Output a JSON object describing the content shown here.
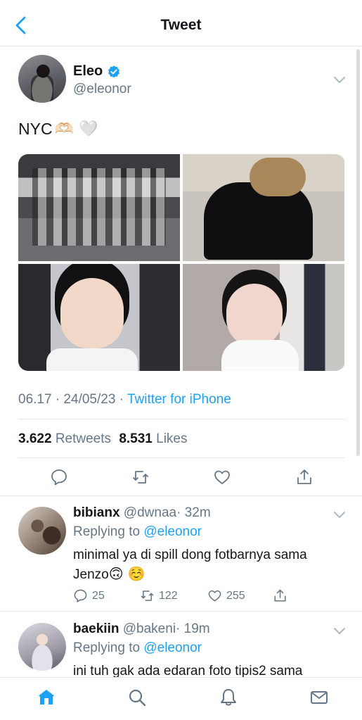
{
  "header": {
    "title": "Tweet"
  },
  "tweet": {
    "name": "Eleo",
    "handle": "@eleonor",
    "text": "NYC",
    "emojis": "🫶🏻 🤍",
    "timestamp": "06.17 · 24/05/23 · ",
    "source": "Twitter for iPhone",
    "retweets_count": "3.622",
    "retweets_label": "Retweets",
    "likes_count": "8.531",
    "likes_label": "Likes"
  },
  "replies": [
    {
      "name": "bibianx",
      "handle": "@dwnaa",
      "time": "· 32m",
      "replying_to": "Replying to",
      "mention": "@eleonor",
      "text": "minimal ya di spill dong fotbarnya sama Jenzo",
      "emojis": "🙃 ☺️",
      "reply_count": "25",
      "retweet_count": "122",
      "like_count": "255"
    },
    {
      "name": "baekiin",
      "handle": "@bakeni",
      "time": "· 19m",
      "replying_to": "Replying to",
      "mention": "@eleonor",
      "text": "ini tuh gak ada edaran foto tipis2 sama"
    }
  ],
  "icons": {
    "back": "chevron-left-icon",
    "verified": "verified-badge-icon",
    "more": "chevron-down-icon",
    "reply": "comment-icon",
    "retweet": "retweet-icon",
    "like": "heart-icon",
    "share": "share-icon",
    "home": "home-icon",
    "search": "search-icon",
    "notifications": "bell-icon",
    "messages": "envelope-icon"
  },
  "colors": {
    "accent": "#1da1f2",
    "secondary_text": "#657786",
    "divider": "#e1e8ed"
  }
}
